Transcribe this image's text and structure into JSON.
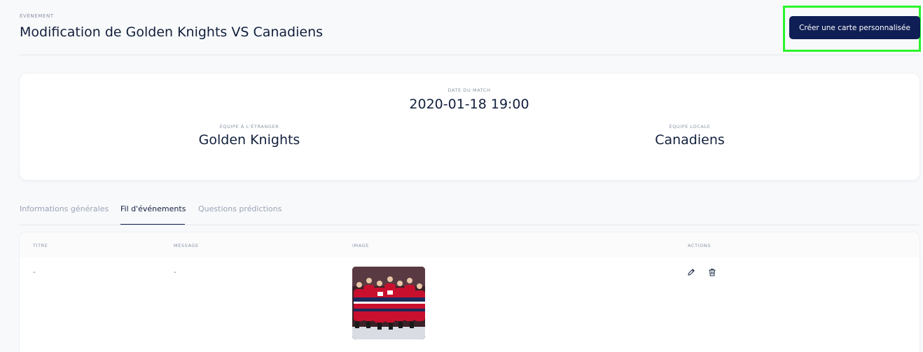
{
  "header": {
    "eyebrow": "ÉVÉNEMENT",
    "title": "Modification de Golden Knights VS Canadiens",
    "create_card_label": "Créer une carte personnalisée"
  },
  "match": {
    "date_label": "DATE DU MATCH",
    "date_value": "2020-01-18 19:00",
    "away_label": "ÉQUIPE À L'ÉTRANGER",
    "away_team": "Golden Knights",
    "home_label": "ÉQUIPE LOCALE",
    "home_team": "Canadiens"
  },
  "tabs": [
    {
      "label": "Informations générales",
      "active": false
    },
    {
      "label": "Fil d'événements",
      "active": true
    },
    {
      "label": "Questions prédictions",
      "active": false
    }
  ],
  "table": {
    "columns": [
      "TITRE",
      "MESSAGE",
      "IMAGE",
      "ACTIONS"
    ],
    "rows": [
      {
        "title": "-",
        "message": "-",
        "image_icon": "hockey-celebration-photo",
        "actions": [
          "edit-icon",
          "trash-icon"
        ]
      }
    ]
  },
  "colors": {
    "primary": "#0f1e54",
    "highlight": "#2af52a",
    "background": "#f8f9fb"
  }
}
